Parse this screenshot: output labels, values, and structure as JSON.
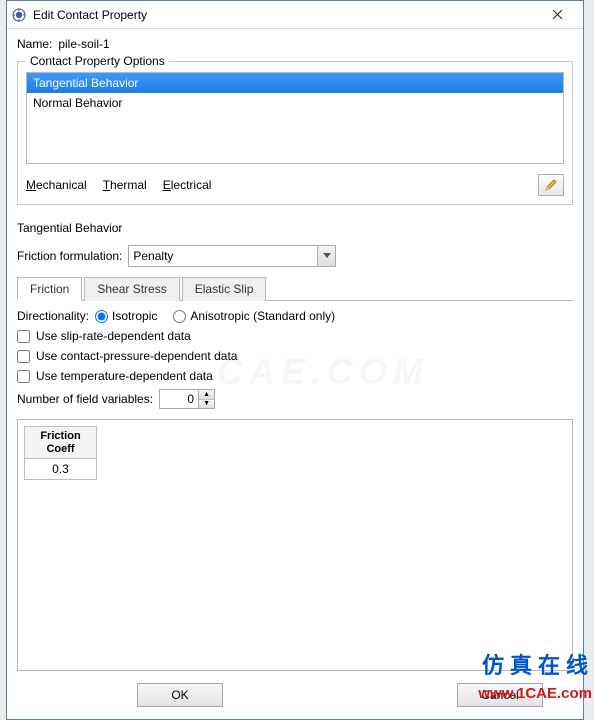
{
  "window": {
    "title": "Edit Contact Property"
  },
  "name": {
    "label": "Name:",
    "value": "pile-soil-1"
  },
  "options": {
    "legend": "Contact Property Options",
    "items": [
      "Tangential Behavior",
      "Normal Behavior"
    ],
    "selected_index": 0,
    "menu": {
      "mechanical": "Mechanical",
      "thermal": "Thermal",
      "electrical": "Electrical"
    }
  },
  "section_title": "Tangential Behavior",
  "friction": {
    "label": "Friction formulation:",
    "value": "Penalty"
  },
  "tabs": [
    "Friction",
    "Shear Stress",
    "Elastic Slip"
  ],
  "active_tab": 0,
  "directionality": {
    "label": "Directionality:",
    "isotropic": "Isotropic",
    "anisotropic": "Anisotropic (Standard only)",
    "selected": "isotropic"
  },
  "checks": {
    "slip": "Use slip-rate-dependent data",
    "pressure": "Use contact-pressure-dependent data",
    "temperature": "Use temperature-dependent data"
  },
  "field_vars": {
    "label": "Number of field variables:",
    "value": "0"
  },
  "table": {
    "header": "Friction\nCoeff",
    "rows": [
      "0.3"
    ]
  },
  "buttons": {
    "ok": "OK",
    "cancel": "Cancel"
  },
  "watermarks": {
    "cn": "仿真在线",
    "url": "www.1CAE.com",
    "bg": "CAE.COM"
  }
}
